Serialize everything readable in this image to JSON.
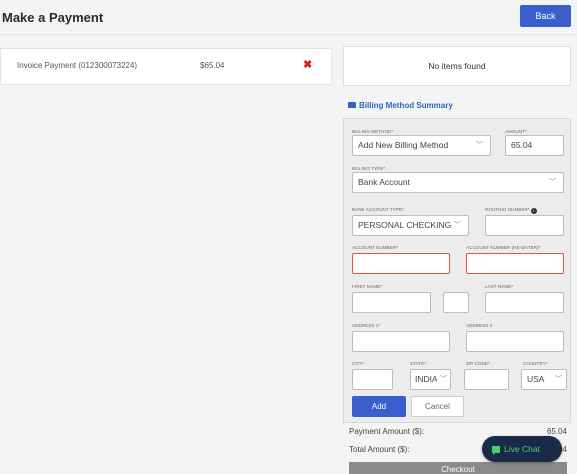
{
  "header": {
    "title": "Make a Payment",
    "back_label": "Back"
  },
  "invoice": {
    "label": "Invoice Payment (012300073224)",
    "amount": "$65.04"
  },
  "cart": {
    "empty_text": "No items found"
  },
  "billing_summary": {
    "link_label": "Billing Method Summary"
  },
  "form": {
    "billing_method": {
      "label": "BILLING METHOD*",
      "value": "Add New Billing Method"
    },
    "amount": {
      "label": "AMOUNT*",
      "value": "65.04"
    },
    "billing_type": {
      "label": "BILLING TYPE*",
      "value": "Bank Account"
    },
    "bank_account_type": {
      "label": "BANK ACCOUNT TYPE*",
      "value": "PERSONAL CHECKING"
    },
    "routing_number": {
      "label": "ROUTING NUMBER*",
      "value": ""
    },
    "account_number": {
      "label": "ACCOUNT NUMBER*",
      "value": ""
    },
    "account_number_reenter": {
      "label": "ACCOUNT NUMBER (RE-ENTER)*",
      "value": ""
    },
    "first_name": {
      "label": "FIRST NAME*",
      "value": ""
    },
    "middle_initial": {
      "value": ""
    },
    "last_name": {
      "label": "LAST NAME*",
      "value": ""
    },
    "address1": {
      "label": "ADDRESS 1*",
      "value": ""
    },
    "address2": {
      "label": "ADDRESS 2",
      "value": ""
    },
    "city": {
      "label": "CITY*",
      "value": ""
    },
    "state": {
      "label": "STATE*",
      "value": "INDIA"
    },
    "zip": {
      "label": "ZIP CODE*",
      "value": ""
    },
    "country": {
      "label": "COUNTRY*",
      "value": "USA"
    },
    "add_label": "Add",
    "cancel_label": "Cancel"
  },
  "totals": {
    "payment_label": "Payment Amount ($):",
    "payment_value": "65.04",
    "total_label": "Total Amount ($):",
    "total_value": "65.04",
    "checkout_label": "Checkout"
  },
  "chat": {
    "label": "Live Chat"
  },
  "colors": {
    "primary": "#3a5fcd",
    "error": "#e05252",
    "chat_bg": "#1c2a4a",
    "chat_fg": "#42d36a"
  }
}
